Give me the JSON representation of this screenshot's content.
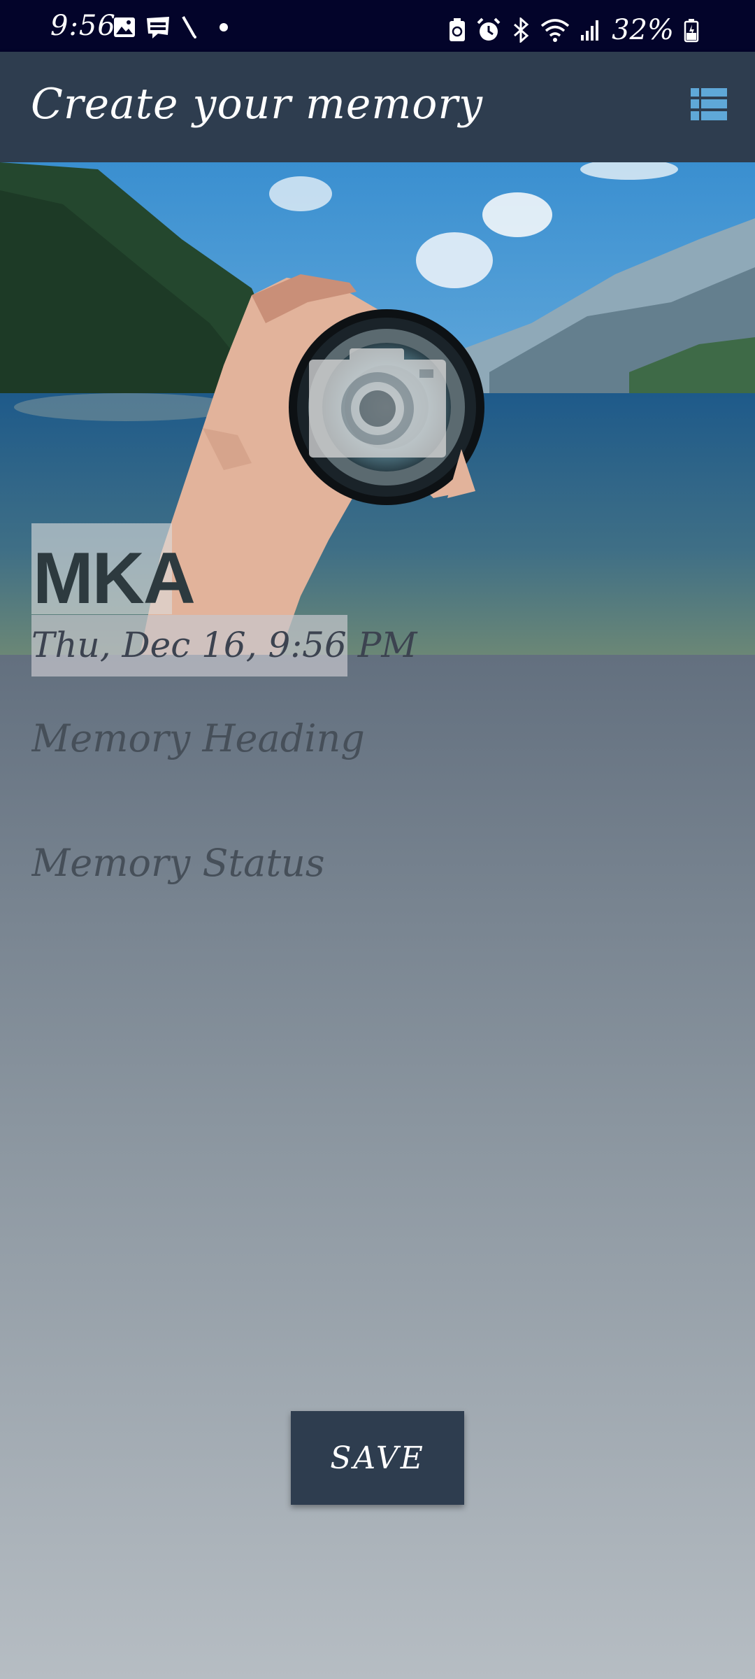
{
  "status_bar": {
    "time": "9:56",
    "left_icons": [
      "image-icon",
      "webtoon-icon",
      "pen-icon",
      "dot-icon"
    ],
    "right_icons": [
      "battery-saver-icon",
      "alarm-icon",
      "bluetooth-icon",
      "wifi-icon",
      "signal-icon"
    ],
    "battery_percent": "32%"
  },
  "app_bar": {
    "title": "Create your memory",
    "list_icon": "list-icon",
    "accent_color": "#5fa8d8",
    "background_color": "#2e3d4f"
  },
  "memory": {
    "author": "MKA",
    "date": "Thu, Dec 16, 9:56 PM",
    "camera_icon": "camera-icon",
    "heading_placeholder": "Memory Heading",
    "heading_value": "",
    "status_placeholder": "Memory Status",
    "status_value": ""
  },
  "actions": {
    "save_label": "SAVE"
  }
}
